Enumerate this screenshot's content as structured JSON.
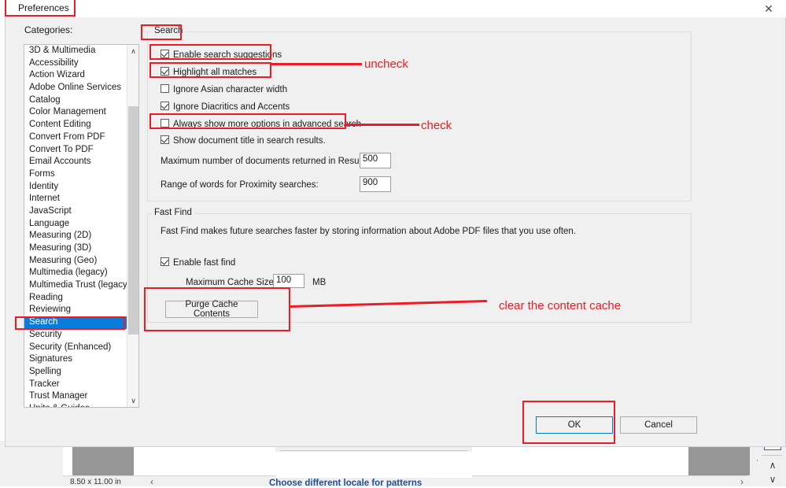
{
  "window": {
    "title": "Preferences",
    "close_icon": "close-icon",
    "close_glyph": "✕"
  },
  "sidebar": {
    "label": "Categories:",
    "selected": "Search",
    "scroll_up_glyph": "∧",
    "scroll_down_glyph": "∨",
    "items": [
      "3D & Multimedia",
      "Accessibility",
      "Action Wizard",
      "Adobe Online Services",
      "Catalog",
      "Color Management",
      "Content Editing",
      "Convert From PDF",
      "Convert To PDF",
      "Email Accounts",
      "Forms",
      "Identity",
      "Internet",
      "JavaScript",
      "Language",
      "Measuring (2D)",
      "Measuring (3D)",
      "Measuring (Geo)",
      "Multimedia (legacy)",
      "Multimedia Trust (legacy)",
      "Reading",
      "Reviewing",
      "Search",
      "Security",
      "Security (Enhanced)",
      "Signatures",
      "Spelling",
      "Tracker",
      "Trust Manager",
      "Units & Guides"
    ]
  },
  "search_group": {
    "legend": "Search",
    "checkboxes": [
      {
        "label": "Enable search suggestions",
        "checked": true
      },
      {
        "label": "Highlight all matches",
        "checked": true
      },
      {
        "label": "Ignore Asian character width",
        "checked": false
      },
      {
        "label": "Ignore Diacritics and Accents",
        "checked": true
      },
      {
        "label": "Always show more options in advanced search",
        "checked": false
      },
      {
        "label": "Show document title in search results.",
        "checked": true
      }
    ],
    "fields": [
      {
        "label": "Maximum number of documents returned in Results:",
        "value": "500"
      },
      {
        "label": "Range of words for Proximity searches:",
        "value": "900"
      }
    ]
  },
  "fastfind_group": {
    "legend": "Fast Find",
    "description": "Fast Find makes future searches faster by storing information about Adobe PDF files that you use often.",
    "enable_checkbox": {
      "label": "Enable fast find",
      "checked": true
    },
    "cache_label": "Maximum Cache Size:",
    "cache_value": "100",
    "cache_unit": "MB",
    "purge_button": "Purge Cache Contents"
  },
  "footer": {
    "ok": "OK",
    "cancel": "Cancel"
  },
  "annotations": {
    "accent_color": "#ed1c24",
    "uncheck": "uncheck",
    "check": "check",
    "clear_cache": "clear the content cache"
  },
  "background": {
    "page_size": "8.50 x 11.00 in",
    "locale_link": "Choose different locale for patterns",
    "left_arrow_glyph": "‹",
    "right_arrow_glyph": "›",
    "up_glyph": "∧",
    "down_glyph": "∨"
  }
}
